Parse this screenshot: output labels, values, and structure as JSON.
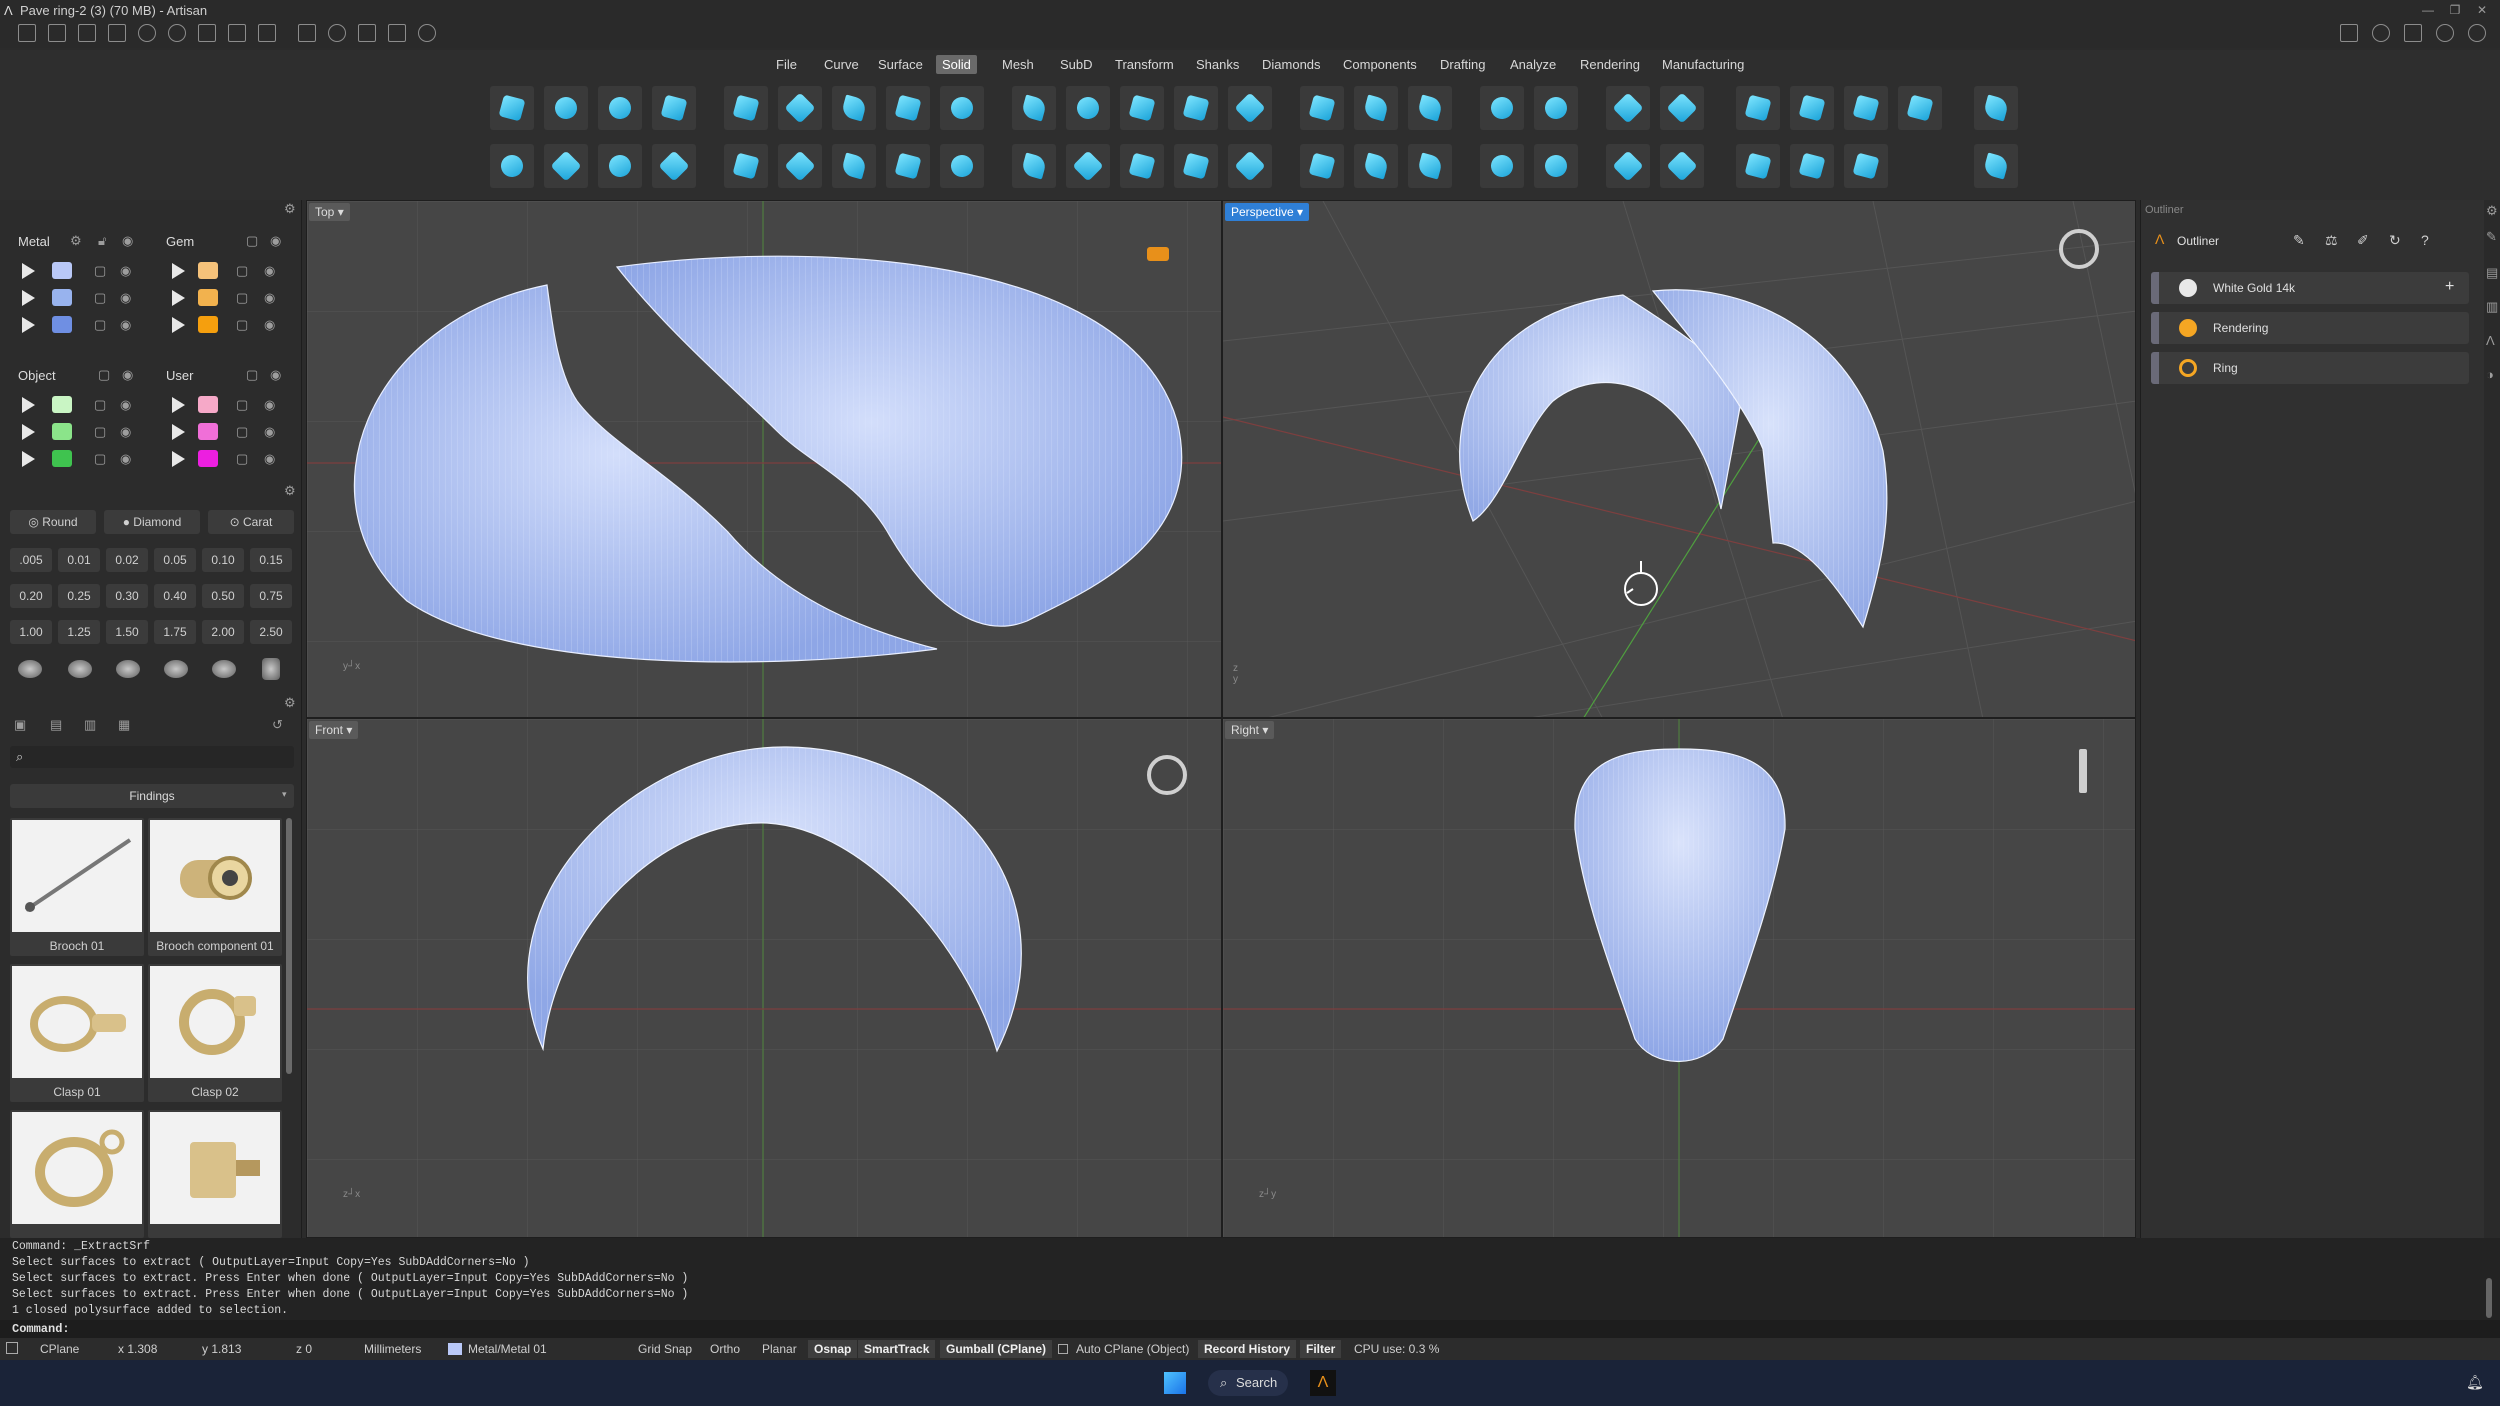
{
  "window": {
    "title": "Pave ring-2 (3) (70 MB) - Artisan"
  },
  "menu": {
    "items": [
      "File",
      "Curve",
      "Surface",
      "Solid",
      "Mesh",
      "SubD",
      "Transform",
      "Shanks",
      "Diamonds",
      "Components",
      "Drafting",
      "Analyze",
      "Rendering",
      "Manufacturing"
    ],
    "active": "Solid"
  },
  "layers": {
    "metal": {
      "title": "Metal",
      "colors": [
        "#b9c8f7",
        "#98b3ee",
        "#6f8fe3"
      ]
    },
    "gem": {
      "title": "Gem",
      "colors": [
        "#f5c27a",
        "#f2b24e",
        "#f59f0e"
      ]
    },
    "object": {
      "title": "Object",
      "colors": [
        "#c9f5c4",
        "#8be48a",
        "#3fc34f"
      ]
    },
    "user": {
      "title": "User",
      "colors": [
        "#f6a9c8",
        "#f06fd8",
        "#ec1fe0"
      ]
    }
  },
  "gems": {
    "shape_buttons": [
      "Round",
      "Diamond",
      "Carat"
    ],
    "sizes": [
      ".005",
      "0.01",
      "0.02",
      "0.05",
      "0.10",
      "0.15",
      "0.20",
      "0.25",
      "0.30",
      "0.40",
      "0.50",
      "0.75",
      "1.00",
      "1.25",
      "1.50",
      "1.75",
      "2.00",
      "2.50"
    ]
  },
  "library": {
    "search_placeholder": "",
    "category": "Findings",
    "items": [
      {
        "label": "Brooch 01"
      },
      {
        "label": "Brooch component 01"
      },
      {
        "label": "Clasp 01"
      },
      {
        "label": "Clasp 02"
      },
      {
        "label": ""
      },
      {
        "label": ""
      }
    ]
  },
  "viewports": {
    "top": {
      "label": "Top"
    },
    "perspective": {
      "label": "Perspective"
    },
    "front": {
      "label": "Front"
    },
    "right": {
      "label": "Right"
    }
  },
  "outliner": {
    "panel_title": "Outliner",
    "header": "Outliner",
    "items": [
      {
        "label": "White Gold 14k",
        "color": "#e8e8e8"
      },
      {
        "label": "Rendering",
        "color": "#f5a623"
      },
      {
        "label": "Ring",
        "color": "#f5a623"
      }
    ]
  },
  "command": {
    "history": [
      "Command: _ExtractSrf",
      "Select surfaces to extract ( OutputLayer=Input  Copy=Yes  SubDAddCorners=No )",
      "Select surfaces to extract. Press Enter when done ( OutputLayer=Input  Copy=Yes  SubDAddCorners=No )",
      "Select surfaces to extract. Press Enter when done ( OutputLayer=Input  Copy=Yes  SubDAddCorners=No )",
      "1 closed polysurface added to selection."
    ],
    "prompt": "Command:"
  },
  "status": {
    "cplane": "CPlane",
    "x": "x 1.308",
    "y": "y 1.813",
    "z": "z 0",
    "units": "Millimeters",
    "layer": "Metal/Metal 01",
    "layer_color": "#b9c8f7",
    "toggles": [
      {
        "label": "Grid Snap",
        "on": false
      },
      {
        "label": "Ortho",
        "on": false
      },
      {
        "label": "Planar",
        "on": false
      },
      {
        "label": "Osnap",
        "on": true
      },
      {
        "label": "SmartTrack",
        "on": true
      },
      {
        "label": "Gumball (CPlane)",
        "on": true
      },
      {
        "label": "Auto CPlane (Object)",
        "on": false
      },
      {
        "label": "Record History",
        "on": true
      },
      {
        "label": "Filter",
        "on": true
      }
    ],
    "cpu": "CPU use: 0.3 %"
  },
  "taskbar": {
    "search": "Search"
  },
  "colors": {
    "accent": "#2f7fd6",
    "surface": "#a9bff0"
  }
}
